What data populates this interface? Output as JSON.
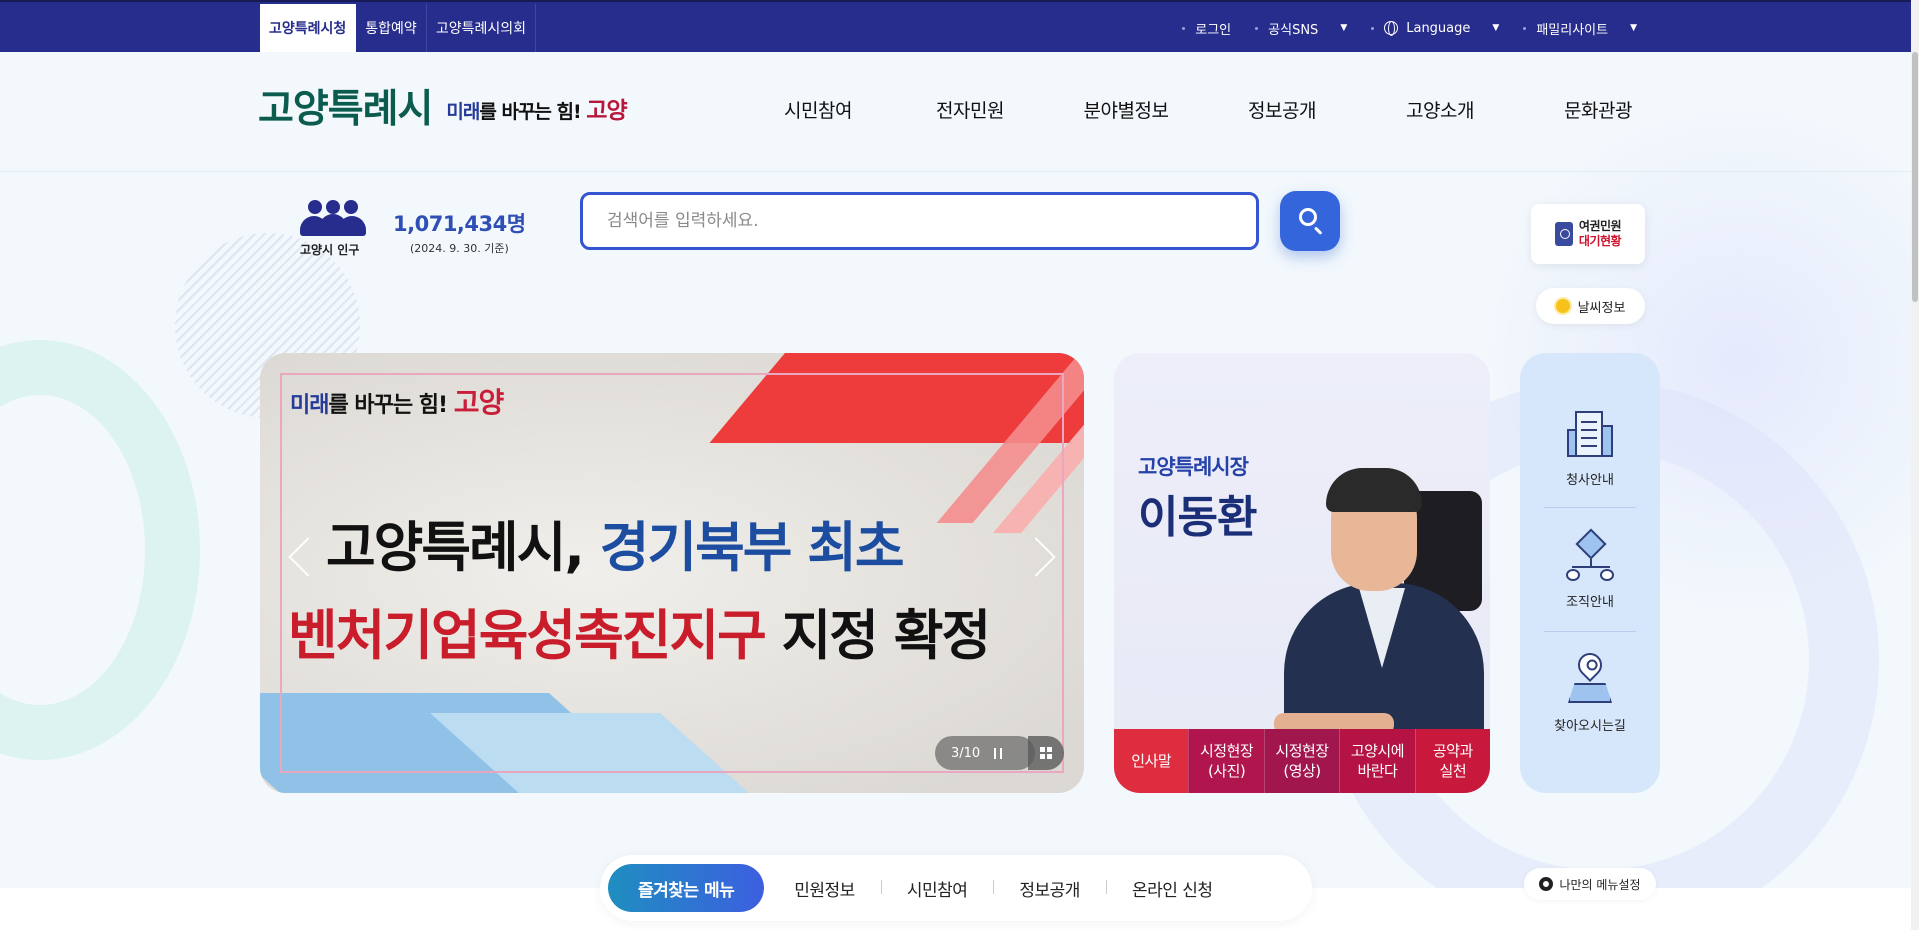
{
  "topbar": {
    "tabs": [
      "고양특례시청",
      "통합예약",
      "고양특례시의회"
    ],
    "login": "로그인",
    "sns": "공식SNS",
    "language": "Language",
    "family": "패밀리사이트"
  },
  "header": {
    "logo_name": "고양특례시",
    "slogan_blue": "미래",
    "slogan_mid": "를 바꾸는 힘!",
    "slogan_red": "고양",
    "gnb": [
      "시민참여",
      "전자민원",
      "분야별정보",
      "정보공개",
      "고양소개",
      "문화관광"
    ]
  },
  "population": {
    "label": "고양시 인구",
    "count": "1,071,434명",
    "date": "(2024. 9. 30. 기준)"
  },
  "search": {
    "placeholder": "검색어를 입력하세요."
  },
  "side": {
    "passport_l1": "여권민원",
    "passport_l2": "대기현황",
    "weather": "날씨정보"
  },
  "banner": {
    "slogan_blue": "미래",
    "slogan_mid": "를 바꾸는 힘!",
    "slogan_red": "고양",
    "line1_black": "고양특례시,",
    "line1_blue": "경기북부 최초",
    "line2_red": "벤처기업육성촉진지구",
    "line2_black": "지정 확정",
    "counter": "3/10"
  },
  "mayor": {
    "title": "고양특례시장",
    "name": "이동환",
    "tabs": [
      {
        "l1": "인사말",
        "l2": ""
      },
      {
        "l1": "시정현장",
        "l2": "(사진)"
      },
      {
        "l1": "시정현장",
        "l2": "(영상)"
      },
      {
        "l1": "고양시에",
        "l2": "바란다"
      },
      {
        "l1": "공약과",
        "l2": "실천"
      }
    ]
  },
  "quick": {
    "items": [
      "청사안내",
      "조직안내",
      "찾아오시는길"
    ]
  },
  "bottom": {
    "tabs": [
      "즐겨찾는 메뉴",
      "민원정보",
      "시민참여",
      "정보공개",
      "온라인 신청"
    ],
    "mymenu": "나만의 메뉴설정"
  },
  "colors": {
    "topbar": "#272d8c",
    "accent": "#3565db",
    "logo": "#0b5c4f",
    "brand_red": "#c91d3a"
  }
}
